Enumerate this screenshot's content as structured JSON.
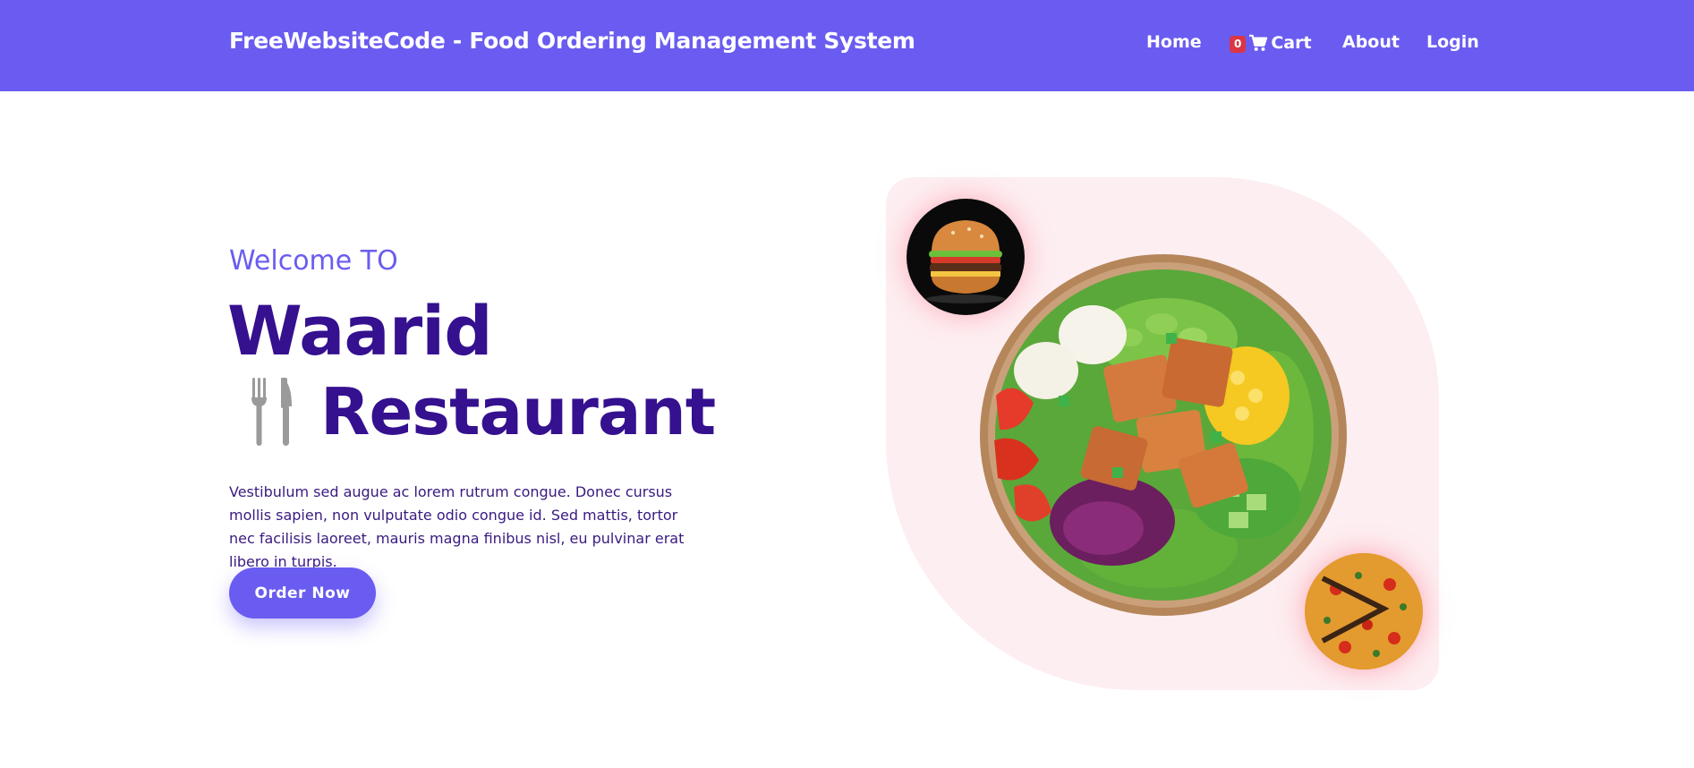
{
  "header": {
    "brand": "FreeWebsiteCode - Food Ordering Management System",
    "nav": {
      "home": "Home",
      "cart_count": "0",
      "cart": "Cart",
      "about": "About",
      "login": "Login"
    }
  },
  "hero": {
    "welcome": "Welcome TO",
    "title_line1": "Waarid",
    "title_line2": "Restaurant",
    "description": "Vestibulum sed augue ac lorem rutrum congue. Donec cursus mollis sapien, non vulputate odio congue id. Sed mattis, tortor nec facilisis laoreet, mauris magna finibus nisl, eu pulvinar erat libero in turpis.",
    "order_button": "Order Now"
  },
  "colors": {
    "primary": "#6a5cf0",
    "heading": "#35108f",
    "hero_bg": "#fdeef1",
    "badge": "#dc3545"
  },
  "icons": {
    "cart": "cart-icon",
    "cutlery": "fork-knife-icon"
  }
}
